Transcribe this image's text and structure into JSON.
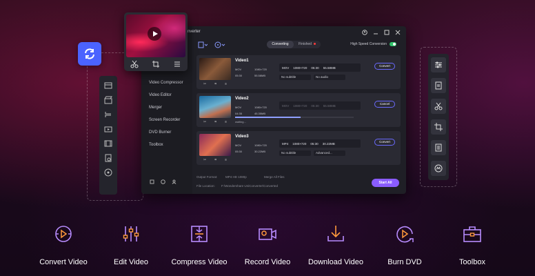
{
  "app": {
    "title": "nverter"
  },
  "window_controls": [
    "account-icon",
    "minimize-icon",
    "maximize-icon",
    "close-icon"
  ],
  "sidebar": {
    "items": [
      "Video Compressor",
      "Video Editor",
      "Merger",
      "Screen Recorder",
      "DVD Burner",
      "Toolbox"
    ]
  },
  "tabs": [
    {
      "label": "Converting",
      "active": true
    },
    {
      "label": "Finished",
      "active": false
    }
  ],
  "high_speed": {
    "label": "High Speed Conversion",
    "enabled": true
  },
  "videos": [
    {
      "name": "Video1",
      "src_format": "MOV",
      "src_res": "1080×720",
      "src_dur": "05:30",
      "src_size": "55.58MB",
      "target_format": "MOV",
      "target_res": "1080×720",
      "target_dur": "05:30",
      "target_size": "55.58MB",
      "subtitle": "No subtitle",
      "audio": "No audio",
      "button": "Convert"
    },
    {
      "name": "Video2",
      "src_format": "MOV",
      "src_res": "1080×720",
      "src_dur": "04:35",
      "src_size": "45.35MB",
      "target_format": "MOV",
      "target_res": "1080×720",
      "target_dur": "05:30",
      "target_size": "55.58MB",
      "status": "waiting...",
      "progress": 0.55,
      "button": "Cancel"
    },
    {
      "name": "Video3",
      "src_format": "MOV",
      "src_res": "1080×720",
      "src_dur": "05:30",
      "src_size": "30.22MB",
      "target_format": "MP4",
      "target_res": "1080×720",
      "target_dur": "05:30",
      "target_size": "30.22MB",
      "subtitle": "No subtitle",
      "audio": "Advanced...",
      "button": "Convert"
    }
  ],
  "footer": {
    "output_label": "Output Format:",
    "output_value": "MP4 HD 1080p",
    "merge_label": "Merge All Files",
    "location_label": "File Location:",
    "location_value": "F:\\Wondershare UniConverter\\Converted",
    "start_all": "Start All"
  },
  "features": [
    {
      "label": "Convert Video",
      "icon": "convert-video-icon"
    },
    {
      "label": "Edit Video",
      "icon": "edit-video-icon"
    },
    {
      "label": "Compress Video",
      "icon": "compress-video-icon"
    },
    {
      "label": "Record Video",
      "icon": "record-video-icon"
    },
    {
      "label": "Download Video",
      "icon": "download-video-icon"
    },
    {
      "label": "Burn DVD",
      "icon": "burn-dvd-icon"
    },
    {
      "label": "Toolbox",
      "icon": "toolbox-icon"
    }
  ],
  "colors": {
    "accent": "#8a5cff",
    "feature_icon": "#b88cff",
    "convert_badge": "#4b63ff",
    "toggle_on": "#30c26a"
  }
}
